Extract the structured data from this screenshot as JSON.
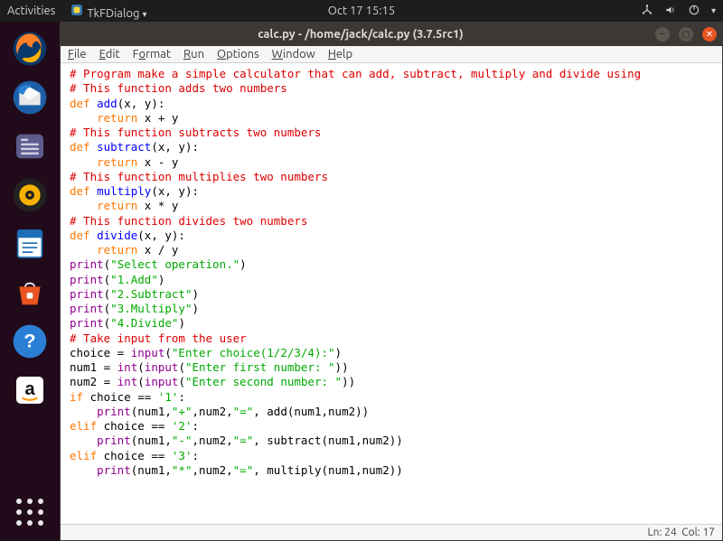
{
  "topbar": {
    "activities": "Activities",
    "app": "TkFDialog",
    "clock": "Oct 17  15:15"
  },
  "window": {
    "title": "calc.py - /home/jack/calc.py (3.7.5rc1)"
  },
  "menubar": {
    "file": "File",
    "edit": "Edit",
    "format": "Format",
    "run": "Run",
    "options": "Options",
    "window": "Window",
    "help": "Help"
  },
  "code": {
    "c1": "# Program make a simple calculator that can add, subtract, multiply and divide using",
    "c2": "# This function adds two numbers",
    "kw_def": "def",
    "fn_add": "add",
    "sig_xy": "(x, y):",
    "kw_return": "return",
    "ret_add": " x + y",
    "c3": "# This function subtracts two numbers",
    "fn_sub": "subtract",
    "ret_sub": " x - y",
    "c4": "# This function multiplies two numbers",
    "fn_mul": "multiply",
    "ret_mul": " x * y",
    "c5": "# This function divides two numbers",
    "fn_div": "divide",
    "ret_div": " x / y",
    "bi_print": "print",
    "s_selop": "\"Select operation.\"",
    "s_opt1": "\"1.Add\"",
    "s_opt2": "\"2.Subtract\"",
    "s_opt3": "\"3.Multiply\"",
    "s_opt4": "\"4.Divide\"",
    "c6": "# Take input from the user",
    "var_choice": "choice = ",
    "bi_input": "input",
    "s_choice": "\"Enter choice(1/2/3/4):\"",
    "var_num1": "num1 = ",
    "var_num2": "num2 = ",
    "bi_int": "int",
    "s_first": "\"Enter first number: \"",
    "s_second": "\"Enter second number: \"",
    "kw_if": "if",
    "kw_elif": "elif",
    "cond1": " choice == ",
    "str1": "'1'",
    "str2": "'2'",
    "str3": "'3'",
    "colon": ":",
    "pa_open": "(num1,",
    "q_plus": "\"+\"",
    "q_minus": "\"-\"",
    "q_star": "\"*\"",
    "q_eq": "\"=\"",
    "comma_num2": ",num2,",
    "comma_sp": ", ",
    "call_add_close": "add(num1,num2))",
    "call_sub_close": "subtract(num1,num2))",
    "call_mul_close": "multiply(num1,num2))",
    "paren_close": ")",
    "paren_close2": "))",
    "indent4": "    ",
    "paren_open": "("
  },
  "status": {
    "ln": "Ln: 24",
    "col": "Col: 17"
  }
}
